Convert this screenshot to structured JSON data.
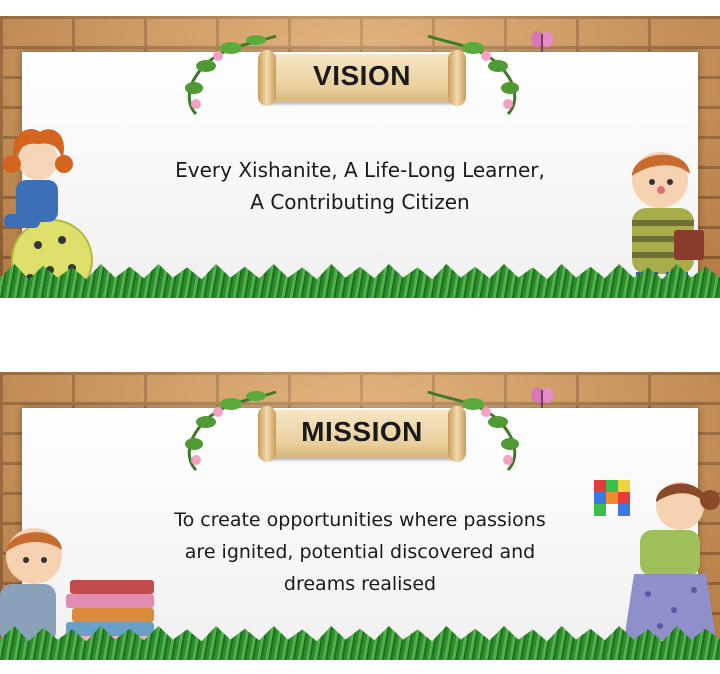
{
  "vision": {
    "title": "VISION",
    "lines": [
      "Every Xishanite, A Life-Long Learner,",
      "A Contributing Citizen"
    ]
  },
  "mission": {
    "title": "MISSION",
    "lines": [
      "To create opportunities where passions",
      "are ignited, potential discovered and",
      "dreams realised"
    ]
  },
  "colors": {
    "brick": "#c58a4e",
    "mortar": "#8a5a2e",
    "board": "#ffffff",
    "grass": "#3a9a36",
    "scroll": "#ecd5a6",
    "text": "#1a1a1a"
  },
  "icons": [
    "vine-icon",
    "flower-icon",
    "butterfly-icon",
    "girl-on-ball-icon",
    "boy-with-book-icon",
    "boy-with-books-icon",
    "girl-with-cube-icon"
  ]
}
